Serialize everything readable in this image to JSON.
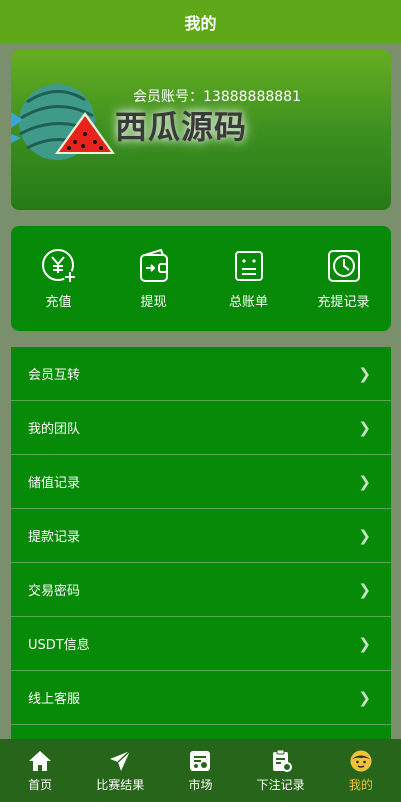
{
  "header": {
    "title": "我的"
  },
  "banner": {
    "account_label": "会员账号：13888888881",
    "logo_text": "西瓜源码"
  },
  "quick_actions": [
    {
      "label": "充值",
      "icon": "recharge-icon"
    },
    {
      "label": "提现",
      "icon": "wallet-icon"
    },
    {
      "label": "总账单",
      "icon": "bill-icon"
    },
    {
      "label": "充提记录",
      "icon": "clock-icon"
    }
  ],
  "menu": [
    {
      "label": "会员互转"
    },
    {
      "label": "我的团队"
    },
    {
      "label": "储值记录"
    },
    {
      "label": "提款记录"
    },
    {
      "label": "交易密码"
    },
    {
      "label": "USDT信息"
    },
    {
      "label": "线上客服"
    }
  ],
  "tabbar": [
    {
      "label": "首页",
      "icon": "home-icon",
      "active": false
    },
    {
      "label": "比赛结果",
      "icon": "send-icon",
      "active": false
    },
    {
      "label": "市场",
      "icon": "market-icon",
      "active": false
    },
    {
      "label": "下注记录",
      "icon": "clipboard-icon",
      "active": false
    },
    {
      "label": "我的",
      "icon": "face-icon",
      "active": true
    }
  ],
  "colors": {
    "header": "#5fa81a",
    "panel": "#078a07",
    "tabbar": "#27661a",
    "active_tab": "#f0c23a"
  }
}
